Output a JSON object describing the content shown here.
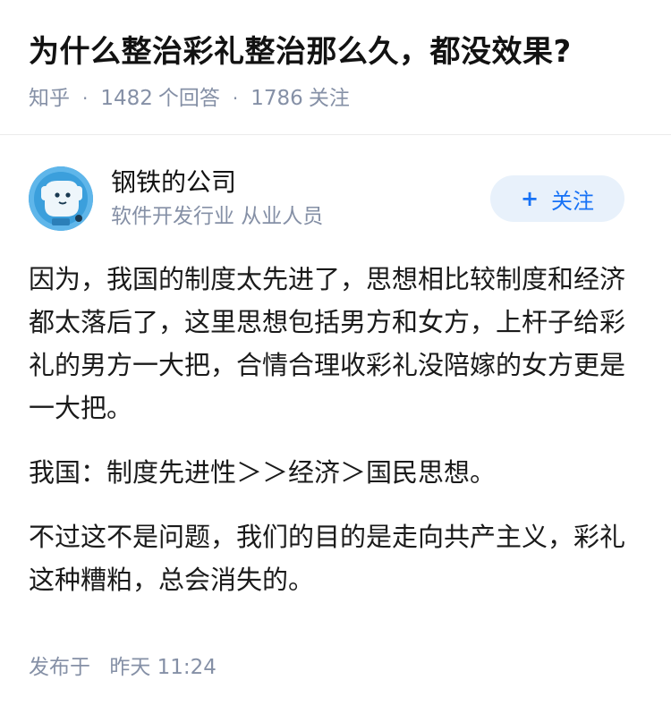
{
  "question": {
    "title": "为什么整治彩礼整治那么久，都没效果?",
    "source": "知乎",
    "answer_count": "1482",
    "answer_count_label": "个回答",
    "follower_count": "1786",
    "follower_count_label": "关注"
  },
  "answer": {
    "author": {
      "name": "钢铁的公司",
      "headline": "软件开发行业 从业人员",
      "avatar_icon": "robot-avatar-icon"
    },
    "follow_button": {
      "icon": "plus-icon",
      "icon_glyph": "+",
      "label": "关注"
    },
    "paragraphs": [
      "因为，我国的制度太先进了，思想相比较制度和经济都太落后了，这里思想包括男方和女方，上杆子给彩礼的男方一大把，合情合理收彩礼没陪嫁的女方更是一大把。",
      "我国：制度先进性＞＞经济＞国民思想。",
      "不过这不是问题，我们的目的是走向共产主义，彩礼这种糟粕，总会消失的。"
    ],
    "publish": {
      "label": "发布于",
      "time": "昨天 11:24"
    }
  },
  "colors": {
    "accent": "#1772f6",
    "follow_bg": "#e8f1fb",
    "meta_text": "#8590a6",
    "avatar_bg": "#3aa0e0"
  }
}
